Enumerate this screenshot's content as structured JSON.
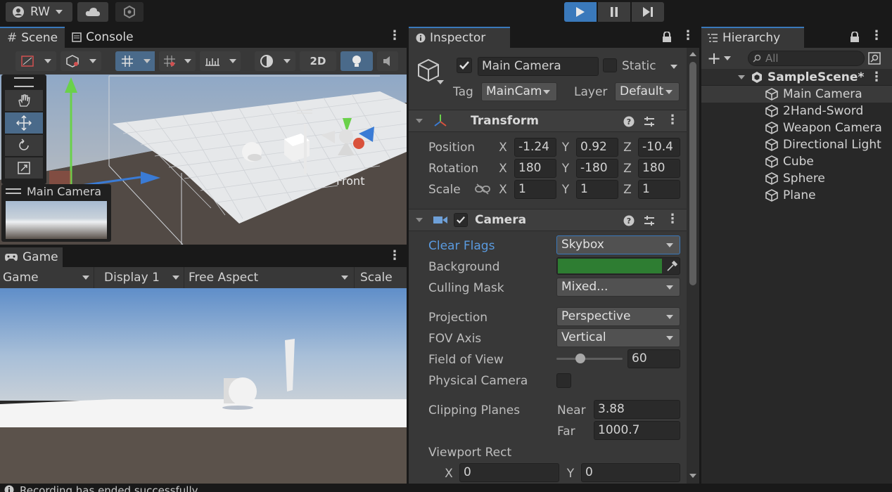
{
  "toolbar": {
    "account_label": "RW",
    "play_icon": "play-icon",
    "pause_icon": "pause-icon",
    "step_icon": "step-icon"
  },
  "scene": {
    "tab_scene": "Scene",
    "tab_console": "Console",
    "mode_2d": "2D",
    "front_label": "Front",
    "camera_preview_title": "Main Camera"
  },
  "game": {
    "tab_label": "Game",
    "display_mode": "Game",
    "display": "Display 1",
    "aspect": "Free Aspect",
    "scale_label": "Scale"
  },
  "inspector": {
    "tab_label": "Inspector",
    "object_name": "Main Camera",
    "static_label": "Static",
    "tag_label": "Tag",
    "tag_value": "MainCam",
    "layer_label": "Layer",
    "layer_value": "Default",
    "transform": {
      "title": "Transform",
      "position_label": "Position",
      "rotation_label": "Rotation",
      "scale_label": "Scale",
      "position": {
        "x": "-1.24",
        "y": "0.92",
        "z": "-10.4"
      },
      "rotation": {
        "x": "180",
        "y": "-180",
        "z": "180"
      },
      "scale": {
        "x": "1",
        "y": "1",
        "z": "1"
      }
    },
    "camera": {
      "title": "Camera",
      "clear_flags_label": "Clear Flags",
      "clear_flags_value": "Skybox",
      "background_label": "Background",
      "background_color": "#2e7d32",
      "culling_mask_label": "Culling Mask",
      "culling_mask_value": "Mixed...",
      "projection_label": "Projection",
      "projection_value": "Perspective",
      "fov_axis_label": "FOV Axis",
      "fov_axis_value": "Vertical",
      "fov_label": "Field of View",
      "fov_value": "60",
      "physical_camera_label": "Physical Camera",
      "clipping_label": "Clipping Planes",
      "near_label": "Near",
      "near_value": "3.88",
      "far_label": "Far",
      "far_value": "1000.7",
      "viewport_label": "Viewport Rect",
      "viewport_x": "0",
      "viewport_y": "0"
    }
  },
  "hierarchy": {
    "tab_label": "Hierarchy",
    "search_placeholder": "All",
    "scene_name": "SampleScene*",
    "items": [
      {
        "label": "Main Camera"
      },
      {
        "label": "2Hand-Sword"
      },
      {
        "label": "Weapon Camera"
      },
      {
        "label": "Directional Light"
      },
      {
        "label": "Cube"
      },
      {
        "label": "Sphere"
      },
      {
        "label": "Plane"
      }
    ]
  },
  "status": {
    "text": "Recording has ended successfully"
  },
  "colors": {
    "accent": "#3a79bb",
    "selected_label": "#5a9be0"
  }
}
